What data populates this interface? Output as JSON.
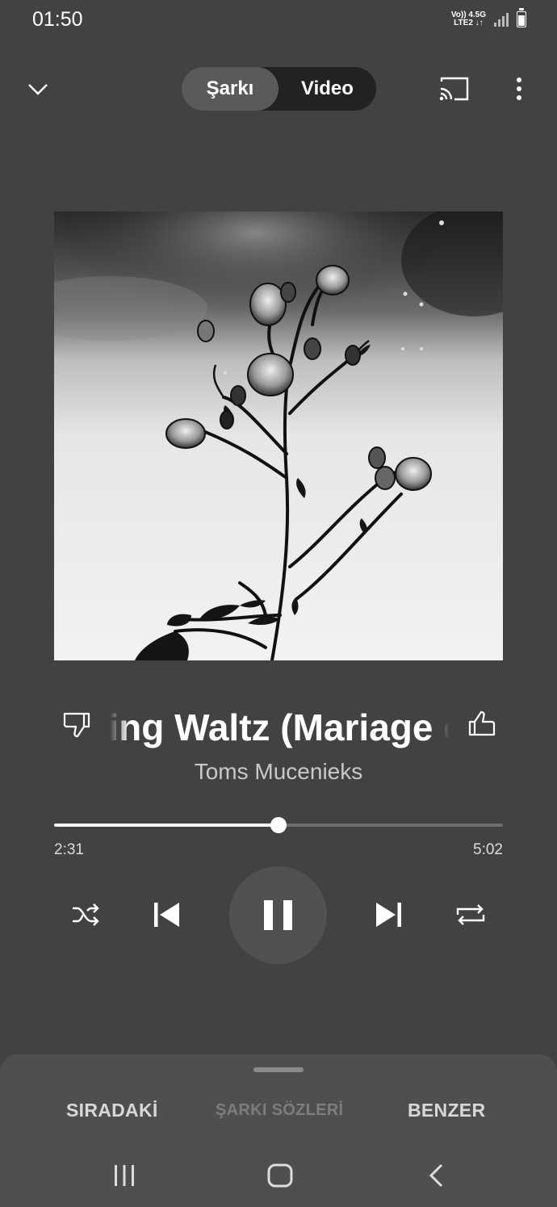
{
  "status": {
    "time": "01:50",
    "network_top": "Vo)) 4.5G",
    "network_bottom": "LTE2 ↓↑"
  },
  "header": {
    "tabs": [
      {
        "label": "Şarkı",
        "selected": true
      },
      {
        "label": "Video",
        "selected": false
      }
    ]
  },
  "player": {
    "title": "Wedding Waltz (Mariage d'Amour)",
    "title_visible": "g Waltz (Mariage d’A",
    "artist": "Toms Mucenieks",
    "elapsed": "2:31",
    "duration": "5:02",
    "progress": 0.5,
    "state": "playing"
  },
  "sheet": {
    "tabs": [
      {
        "label": "SIRADAKİ",
        "enabled": true
      },
      {
        "label": "ŞARKI SÖZLERİ",
        "enabled": false
      },
      {
        "label": "BENZER",
        "enabled": true
      }
    ]
  },
  "colors": {
    "background": "#424242",
    "toggle_bg": "#222222",
    "toggle_selected": "#5a5a5a",
    "sheet_bg": "#4f4f4f",
    "progress_fill": "#ffffff"
  }
}
